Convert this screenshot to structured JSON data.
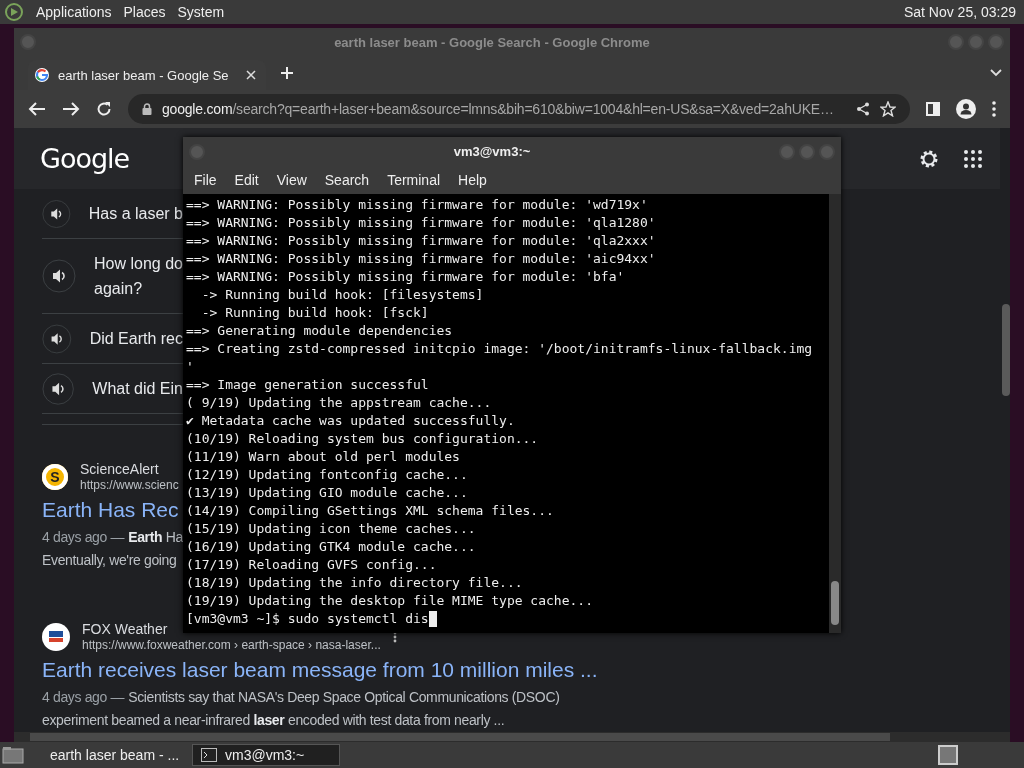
{
  "top_panel": {
    "menus": [
      "Applications",
      "Places",
      "System"
    ],
    "clock": "Sat Nov 25, 03:29"
  },
  "browser": {
    "title": "earth laser beam - Google Search - Google Chrome",
    "tabs": [
      {
        "label": "earth laser beam - Google Se",
        "selected": true
      }
    ],
    "address": {
      "host": "google.com",
      "rest": "/search?q=earth+laser+beam&source=lmns&bih=610&biw=1004&hl=en-US&sa=X&ved=2ahUKE…"
    },
    "page": {
      "logo": "Google",
      "questions": [
        {
          "lines": [
            "Has a laser b"
          ]
        },
        {
          "lines": [
            "How long do",
            "again?"
          ]
        },
        {
          "lines": [
            "Did Earth rec"
          ]
        },
        {
          "lines": [
            "What did Ein"
          ]
        }
      ],
      "results": [
        {
          "badge": "S",
          "source": "ScienceAlert",
          "url": "https://www.scienc",
          "title": "Earth Has Rec",
          "date": "4 days ago —",
          "snippet_lines": [
            "**Earth** Ha",
            "Eventually, we're going"
          ]
        },
        {
          "source": "FOX Weather",
          "url": "https://www.foxweather.com › earth-space › nasa-laser...",
          "title": "Earth receives laser beam message from 10 million miles ...",
          "date": "4 days ago —",
          "snippet_lines": [
            "Scientists say that NASA's Deep Space Optical Communications (DSOC)",
            "experiment beamed a near-infrared **laser** encoded with test data from nearly ..."
          ]
        }
      ]
    }
  },
  "terminal": {
    "title": "vm3@vm3:~",
    "menus": [
      "File",
      "Edit",
      "View",
      "Search",
      "Terminal",
      "Help"
    ],
    "lines": [
      "==> WARNING: Possibly missing firmware for module: 'wd719x'",
      "==> WARNING: Possibly missing firmware for module: 'qla1280'",
      "==> WARNING: Possibly missing firmware for module: 'qla2xxx'",
      "==> WARNING: Possibly missing firmware for module: 'aic94xx'",
      "==> WARNING: Possibly missing firmware for module: 'bfa'",
      "  -> Running build hook: [filesystems]",
      "  -> Running build hook: [fsck]",
      "==> Generating module dependencies",
      "==> Creating zstd-compressed initcpio image: '/boot/initramfs-linux-fallback.img",
      "'",
      "==> Image generation successful",
      "( 9/19) Updating the appstream cache...",
      "✔ Metadata cache was updated successfully.",
      "(10/19) Reloading system bus configuration...",
      "(11/19) Warn about old perl modules",
      "(12/19) Updating fontconfig cache...",
      "(13/19) Updating GIO module cache...",
      "(14/19) Compiling GSettings XML schema files...",
      "(15/19) Updating icon theme caches...",
      "(16/19) Updating GTK4 module cache...",
      "(17/19) Reloading GVFS config...",
      "(18/19) Updating the info directory file...",
      "(19/19) Updating the desktop file MIME type cache..."
    ],
    "prompt": "[vm3@vm3 ~]$ sudo systemctl dis"
  },
  "taskbar": {
    "items": [
      {
        "kind": "browser",
        "label": "earth laser beam - ...",
        "selected": false
      },
      {
        "kind": "terminal",
        "label": "vm3@vm3:~",
        "selected": true
      }
    ]
  }
}
